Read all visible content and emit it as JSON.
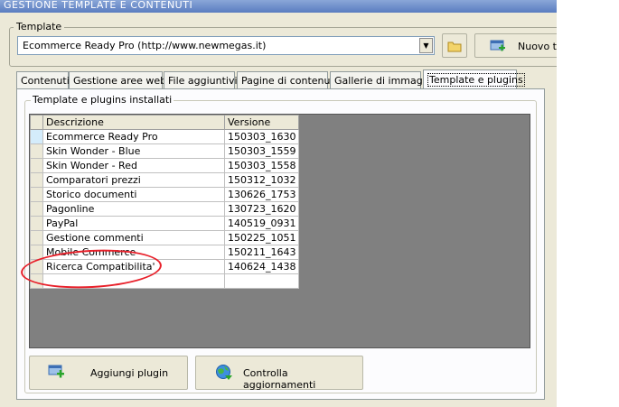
{
  "window": {
    "title": "GESTIONE TEMPLATE E CONTENUTI"
  },
  "template_group": {
    "label": "Template",
    "selected": "Ecommerce Ready Pro (http://www.newmegas.it)",
    "new_button": "Nuovo te"
  },
  "tabs": [
    {
      "label": "Contenuti"
    },
    {
      "label": "Gestione aree web"
    },
    {
      "label": "File aggiuntivi"
    },
    {
      "label": "Pagine di contenuti"
    },
    {
      "label": "Gallerie di immagini"
    },
    {
      "label": "Template e plugins"
    }
  ],
  "plugins": {
    "label": "Template e plugins installati",
    "columns": {
      "description": "Descrizione",
      "version": "Versione"
    },
    "rows": [
      {
        "description": "Ecommerce Ready Pro",
        "version": "150303_1630"
      },
      {
        "description": "Skin Wonder - Blue",
        "version": "150303_1559"
      },
      {
        "description": "Skin Wonder - Red",
        "version": "150303_1558"
      },
      {
        "description": "Comparatori prezzi",
        "version": "150312_1032"
      },
      {
        "description": "Storico documenti",
        "version": "130626_1753"
      },
      {
        "description": "Pagonline",
        "version": "130723_1620"
      },
      {
        "description": "PayPal",
        "version": "140519_0931"
      },
      {
        "description": "Gestione commenti",
        "version": "150225_1051"
      },
      {
        "description": "Mobile Commerce",
        "version": "150211_1643"
      },
      {
        "description": "Ricerca Compatibilita'",
        "version": "140624_1438"
      },
      {
        "description": "",
        "version": ""
      }
    ]
  },
  "buttons": {
    "add_plugin": "Aggiungi plugin",
    "check_updates": "Controlla aggiornamenti"
  },
  "colors": {
    "annotation": "#e8202a",
    "grid_background": "#808080",
    "accent": "#f6d35a"
  }
}
